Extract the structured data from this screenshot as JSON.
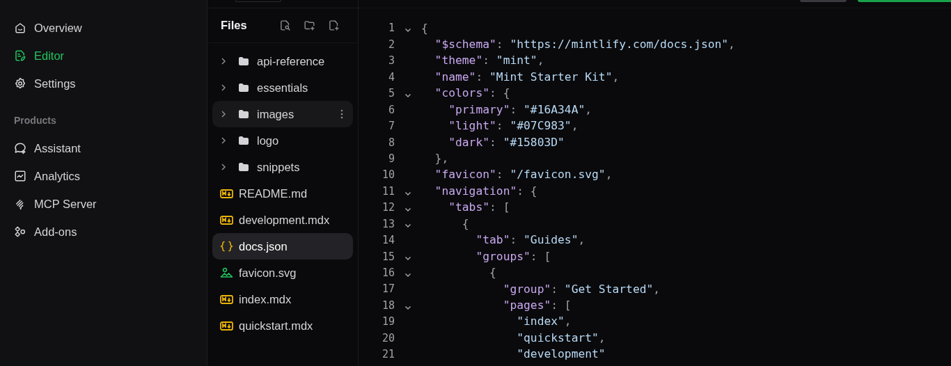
{
  "sidebar": {
    "items": [
      {
        "label": "Overview",
        "selected": false
      },
      {
        "label": "Editor",
        "selected": true
      },
      {
        "label": "Settings",
        "selected": false
      }
    ],
    "section": {
      "title": "Products",
      "items": [
        {
          "label": "Assistant",
          "selected": false
        },
        {
          "label": "Analytics",
          "selected": false
        },
        {
          "label": "MCP Server",
          "selected": false
        },
        {
          "label": "Add-ons",
          "selected": false
        }
      ]
    }
  },
  "files": {
    "title": "Files",
    "entries": [
      {
        "name": "api-reference",
        "kind": "folder",
        "selected": false,
        "hovered": false
      },
      {
        "name": "essentials",
        "kind": "folder",
        "selected": false,
        "hovered": false
      },
      {
        "name": "images",
        "kind": "folder",
        "selected": false,
        "hovered": true
      },
      {
        "name": "logo",
        "kind": "folder",
        "selected": false,
        "hovered": false
      },
      {
        "name": "snippets",
        "kind": "folder",
        "selected": false,
        "hovered": false
      },
      {
        "name": "README.md",
        "kind": "markdown",
        "selected": false,
        "hovered": false
      },
      {
        "name": "development.mdx",
        "kind": "markdown",
        "selected": false,
        "hovered": false
      },
      {
        "name": "docs.json",
        "kind": "json",
        "selected": true,
        "hovered": false
      },
      {
        "name": "favicon.svg",
        "kind": "image",
        "selected": false,
        "hovered": false
      },
      {
        "name": "index.mdx",
        "kind": "markdown",
        "selected": false,
        "hovered": false
      },
      {
        "name": "quickstart.mdx",
        "kind": "markdown",
        "selected": false,
        "hovered": false
      }
    ]
  },
  "editor": {
    "lines": [
      {
        "number": "1",
        "foldable": true,
        "tokens": [
          {
            "kind": "punct",
            "text": "{"
          }
        ]
      },
      {
        "number": "2",
        "foldable": false,
        "tokens": [
          {
            "kind": "key",
            "text": "  \"$schema\""
          },
          {
            "kind": "punct",
            "text": ": "
          },
          {
            "kind": "string",
            "text": "\"https://mintlify.com/docs.json\""
          },
          {
            "kind": "punct",
            "text": ","
          }
        ]
      },
      {
        "number": "3",
        "foldable": false,
        "tokens": [
          {
            "kind": "key",
            "text": "  \"theme\""
          },
          {
            "kind": "punct",
            "text": ": "
          },
          {
            "kind": "string",
            "text": "\"mint\""
          },
          {
            "kind": "punct",
            "text": ","
          }
        ]
      },
      {
        "number": "4",
        "foldable": false,
        "tokens": [
          {
            "kind": "key",
            "text": "  \"name\""
          },
          {
            "kind": "punct",
            "text": ": "
          },
          {
            "kind": "string",
            "text": "\"Mint Starter Kit\""
          },
          {
            "kind": "punct",
            "text": ","
          }
        ]
      },
      {
        "number": "5",
        "foldable": true,
        "tokens": [
          {
            "kind": "key",
            "text": "  \"colors\""
          },
          {
            "kind": "punct",
            "text": ": {"
          }
        ]
      },
      {
        "number": "6",
        "foldable": false,
        "tokens": [
          {
            "kind": "key",
            "text": "    \"primary\""
          },
          {
            "kind": "punct",
            "text": ": "
          },
          {
            "kind": "string",
            "text": "\"#16A34A\""
          },
          {
            "kind": "punct",
            "text": ","
          }
        ]
      },
      {
        "number": "7",
        "foldable": false,
        "tokens": [
          {
            "kind": "key",
            "text": "    \"light\""
          },
          {
            "kind": "punct",
            "text": ": "
          },
          {
            "kind": "string",
            "text": "\"#07C983\""
          },
          {
            "kind": "punct",
            "text": ","
          }
        ]
      },
      {
        "number": "8",
        "foldable": false,
        "tokens": [
          {
            "kind": "key",
            "text": "    \"dark\""
          },
          {
            "kind": "punct",
            "text": ": "
          },
          {
            "kind": "string",
            "text": "\"#15803D\""
          }
        ]
      },
      {
        "number": "9",
        "foldable": false,
        "tokens": [
          {
            "kind": "punct",
            "text": "  },"
          }
        ]
      },
      {
        "number": "10",
        "foldable": false,
        "tokens": [
          {
            "kind": "key",
            "text": "  \"favicon\""
          },
          {
            "kind": "punct",
            "text": ": "
          },
          {
            "kind": "string",
            "text": "\"/favicon.svg\""
          },
          {
            "kind": "punct",
            "text": ","
          }
        ]
      },
      {
        "number": "11",
        "foldable": true,
        "tokens": [
          {
            "kind": "key",
            "text": "  \"navigation\""
          },
          {
            "kind": "punct",
            "text": ": {"
          }
        ]
      },
      {
        "number": "12",
        "foldable": true,
        "tokens": [
          {
            "kind": "key",
            "text": "    \"tabs\""
          },
          {
            "kind": "punct",
            "text": ": ["
          }
        ]
      },
      {
        "number": "13",
        "foldable": true,
        "tokens": [
          {
            "kind": "punct",
            "text": "      {"
          }
        ]
      },
      {
        "number": "14",
        "foldable": false,
        "tokens": [
          {
            "kind": "key",
            "text": "        \"tab\""
          },
          {
            "kind": "punct",
            "text": ": "
          },
          {
            "kind": "string",
            "text": "\"Guides\""
          },
          {
            "kind": "punct",
            "text": ","
          }
        ]
      },
      {
        "number": "15",
        "foldable": true,
        "tokens": [
          {
            "kind": "key",
            "text": "        \"groups\""
          },
          {
            "kind": "punct",
            "text": ": ["
          }
        ]
      },
      {
        "number": "16",
        "foldable": true,
        "tokens": [
          {
            "kind": "punct",
            "text": "          {"
          }
        ]
      },
      {
        "number": "17",
        "foldable": false,
        "tokens": [
          {
            "kind": "key",
            "text": "            \"group\""
          },
          {
            "kind": "punct",
            "text": ": "
          },
          {
            "kind": "string",
            "text": "\"Get Started\""
          },
          {
            "kind": "punct",
            "text": ","
          }
        ]
      },
      {
        "number": "18",
        "foldable": true,
        "tokens": [
          {
            "kind": "key",
            "text": "            \"pages\""
          },
          {
            "kind": "punct",
            "text": ": ["
          }
        ]
      },
      {
        "number": "19",
        "foldable": false,
        "tokens": [
          {
            "kind": "string",
            "text": "              \"index\""
          },
          {
            "kind": "punct",
            "text": ","
          }
        ]
      },
      {
        "number": "20",
        "foldable": false,
        "tokens": [
          {
            "kind": "string",
            "text": "              \"quickstart\""
          },
          {
            "kind": "punct",
            "text": ","
          }
        ]
      },
      {
        "number": "21",
        "foldable": false,
        "tokens": [
          {
            "kind": "string",
            "text": "              \"development\""
          }
        ]
      }
    ]
  }
}
